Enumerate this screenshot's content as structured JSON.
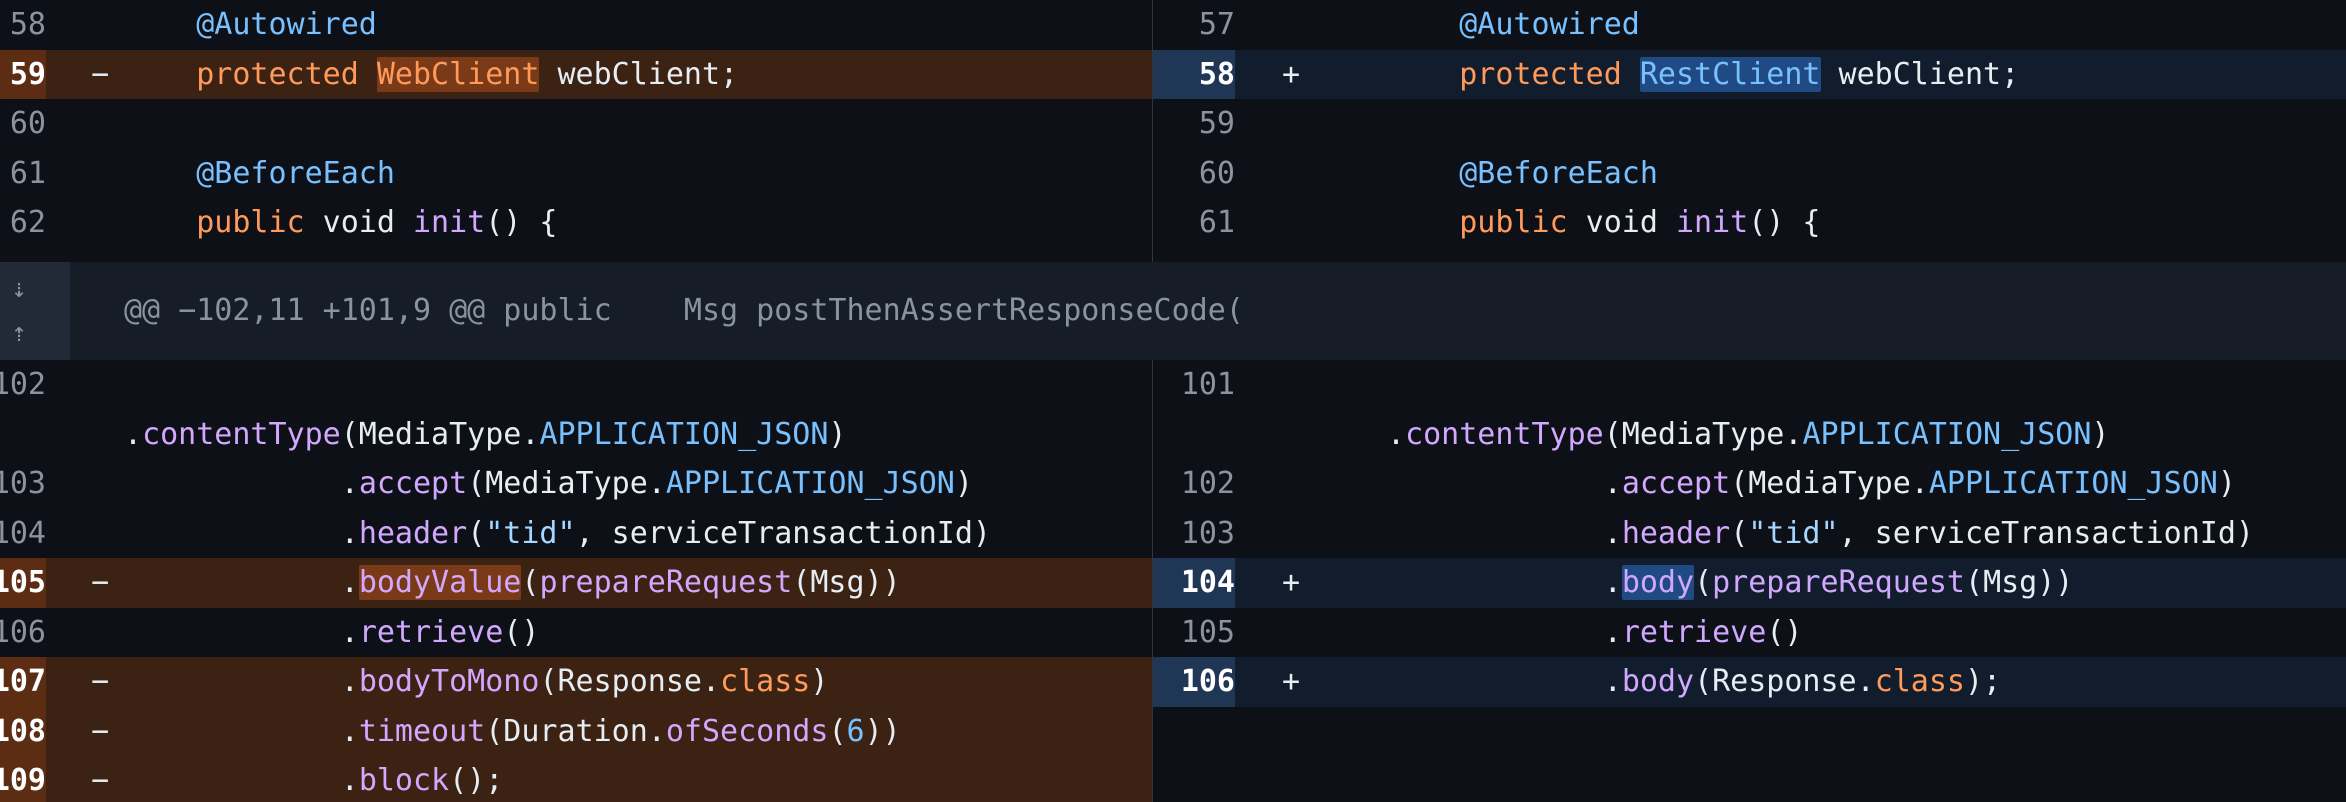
{
  "left": {
    "rows_top": [
      {
        "num": "58",
        "sign": "",
        "type": "ctx",
        "parts": [
          [
            "    ",
            "p"
          ],
          [
            "@Autowired",
            "a"
          ]
        ]
      },
      {
        "num": "59",
        "sign": "−",
        "type": "del",
        "parts": [
          [
            "    ",
            "p"
          ],
          [
            "protected",
            "k"
          ],
          [
            " ",
            "p"
          ],
          [
            "WebClient",
            "k hl-del"
          ],
          [
            " webClient;",
            "p"
          ]
        ]
      },
      {
        "num": "60",
        "sign": "",
        "type": "ctx",
        "parts": []
      },
      {
        "num": "61",
        "sign": "",
        "type": "ctx",
        "parts": [
          [
            "    ",
            "p"
          ],
          [
            "@BeforeEach",
            "a"
          ]
        ]
      },
      {
        "num": "62",
        "sign": "",
        "type": "ctx",
        "parts": [
          [
            "    ",
            "p"
          ],
          [
            "public",
            "k"
          ],
          [
            " void ",
            "p"
          ],
          [
            "init",
            "m"
          ],
          [
            "() {",
            "p"
          ]
        ]
      }
    ],
    "rows_bottom": [
      {
        "num": "102",
        "sign": "",
        "type": "ctx",
        "tall": true,
        "parts": [
          [
            ".",
            "p"
          ],
          [
            "contentType",
            "m"
          ],
          [
            "(MediaType.",
            "p"
          ],
          [
            "APPLICATION_JSON",
            "c"
          ],
          [
            ")",
            "p"
          ]
        ]
      },
      {
        "num": "103",
        "sign": "",
        "type": "ctx",
        "parts": [
          [
            "            .",
            "p"
          ],
          [
            "accept",
            "m"
          ],
          [
            "(MediaType.",
            "p"
          ],
          [
            "APPLICATION_JSON",
            "c"
          ],
          [
            ")",
            "p"
          ]
        ]
      },
      {
        "num": "104",
        "sign": "",
        "type": "ctx",
        "parts": [
          [
            "            .",
            "p"
          ],
          [
            "header",
            "m"
          ],
          [
            "(",
            "p"
          ],
          [
            "\"tid\"",
            "s"
          ],
          [
            ", serviceTransactionId)",
            "p"
          ]
        ]
      },
      {
        "num": "105",
        "sign": "−",
        "type": "del",
        "parts": [
          [
            "            .",
            "p"
          ],
          [
            "bodyValue",
            "m hl-del"
          ],
          [
            "(",
            "p"
          ],
          [
            "prepareRequest",
            "m"
          ],
          [
            "(",
            "p"
          ],
          [
            "Msg",
            "p"
          ],
          [
            "))",
            "p"
          ]
        ]
      },
      {
        "num": "106",
        "sign": "",
        "type": "ctx",
        "parts": [
          [
            "            .",
            "p"
          ],
          [
            "retrieve",
            "m"
          ],
          [
            "()",
            "p"
          ]
        ]
      },
      {
        "num": "107",
        "sign": "−",
        "type": "del",
        "parts": [
          [
            "            .",
            "p"
          ],
          [
            "bodyToMono",
            "m"
          ],
          [
            "(Response.",
            "p"
          ],
          [
            "class",
            "k"
          ],
          [
            ")",
            "p"
          ]
        ]
      },
      {
        "num": "108",
        "sign": "−",
        "type": "del",
        "parts": [
          [
            "            .",
            "p"
          ],
          [
            "timeout",
            "m"
          ],
          [
            "(Duration.",
            "p"
          ],
          [
            "ofSeconds",
            "m"
          ],
          [
            "(",
            "p"
          ],
          [
            "6",
            "n"
          ],
          [
            "))",
            "p"
          ]
        ]
      },
      {
        "num": "109",
        "sign": "−",
        "type": "del",
        "parts": [
          [
            "            .",
            "p"
          ],
          [
            "block",
            "m"
          ],
          [
            "();",
            "p"
          ]
        ]
      }
    ]
  },
  "right": {
    "rows_top": [
      {
        "num": "57",
        "sign": "",
        "type": "ctx",
        "parts": [
          [
            "    ",
            "p"
          ],
          [
            "@Autowired",
            "a"
          ]
        ]
      },
      {
        "num": "58",
        "sign": "+",
        "type": "add",
        "parts": [
          [
            "    ",
            "p"
          ],
          [
            "protected",
            "k"
          ],
          [
            " ",
            "p"
          ],
          [
            "RestClient",
            "c hl-add"
          ],
          [
            " webClient;",
            "p"
          ]
        ]
      },
      {
        "num": "59",
        "sign": "",
        "type": "ctx",
        "parts": []
      },
      {
        "num": "60",
        "sign": "",
        "type": "ctx",
        "parts": [
          [
            "    ",
            "p"
          ],
          [
            "@BeforeEach",
            "a"
          ]
        ]
      },
      {
        "num": "61",
        "sign": "",
        "type": "ctx",
        "parts": [
          [
            "    ",
            "p"
          ],
          [
            "public",
            "k"
          ],
          [
            " void ",
            "p"
          ],
          [
            "init",
            "m"
          ],
          [
            "() {",
            "p"
          ]
        ]
      }
    ],
    "rows_bottom": [
      {
        "num": "101",
        "sign": "",
        "type": "ctx",
        "tall": true,
        "parts": [
          [
            ".",
            "p"
          ],
          [
            "contentType",
            "m"
          ],
          [
            "(MediaType.",
            "p"
          ],
          [
            "APPLICATION_JSON",
            "c"
          ],
          [
            ")",
            "p"
          ]
        ]
      },
      {
        "num": "102",
        "sign": "",
        "type": "ctx",
        "parts": [
          [
            "            .",
            "p"
          ],
          [
            "accept",
            "m"
          ],
          [
            "(MediaType.",
            "p"
          ],
          [
            "APPLICATION_JSON",
            "c"
          ],
          [
            ")",
            "p"
          ]
        ]
      },
      {
        "num": "103",
        "sign": "",
        "type": "ctx",
        "parts": [
          [
            "            .",
            "p"
          ],
          [
            "header",
            "m"
          ],
          [
            "(",
            "p"
          ],
          [
            "\"tid\"",
            "s"
          ],
          [
            ", serviceTransactionId)",
            "p"
          ]
        ]
      },
      {
        "num": "104",
        "sign": "+",
        "type": "add",
        "parts": [
          [
            "            .",
            "p"
          ],
          [
            "body",
            "m hl-add"
          ],
          [
            "(",
            "p"
          ],
          [
            "prepareRequest",
            "m"
          ],
          [
            "(",
            "p"
          ],
          [
            "Msg",
            "p"
          ],
          [
            "))",
            "p"
          ]
        ]
      },
      {
        "num": "105",
        "sign": "",
        "type": "ctx",
        "parts": [
          [
            "            .",
            "p"
          ],
          [
            "retrieve",
            "m"
          ],
          [
            "()",
            "p"
          ]
        ]
      },
      {
        "num": "106",
        "sign": "+",
        "type": "add",
        "parts": [
          [
            "            .",
            "p"
          ],
          [
            "body",
            "m"
          ],
          [
            "(Response.",
            "p"
          ],
          [
            "class",
            "k"
          ],
          [
            ");",
            "p"
          ]
        ]
      }
    ]
  },
  "hunk": {
    "text": "@@ −102,11 +101,9 @@ public    Msg postThenAssertResponseCode(",
    "expand_down_icon": "arrow-down-dotted-icon",
    "expand_up_icon": "arrow-up-dotted-icon"
  },
  "colors": {
    "background": "#0d1117",
    "deletion_row": "#3b2212",
    "addition_row": "#111c2c",
    "keyword": "#ff9a5a",
    "annotation": "#79c0ff",
    "method": "#d2a8ff"
  }
}
